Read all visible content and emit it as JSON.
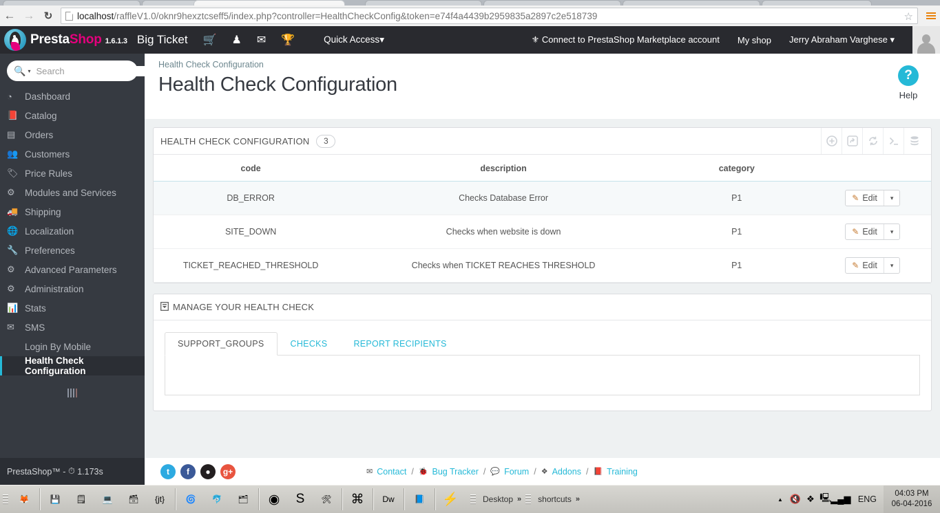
{
  "browser": {
    "back_icon": "back-arrow-icon",
    "forward_icon": "forward-arrow-icon",
    "reload_icon": "reload-icon",
    "url_host": "localhost",
    "url_path": "/raffleV1.0/oknr9hexztcseff5/index.php?controller=HealthCheckConfig&token=e74f4a4439b2959835a2897c2e518739",
    "star_icon": "☆",
    "menu_icon": "menu-icon"
  },
  "header": {
    "brand_presta": "Presta",
    "brand_shop": "Shop",
    "version": "1.6.1.3",
    "shop_name": "Big Ticket",
    "icons": [
      {
        "name": "cart-icon",
        "glyph": "🛒"
      },
      {
        "name": "customers-icon",
        "glyph": "♟"
      },
      {
        "name": "mail-icon",
        "glyph": "✉"
      },
      {
        "name": "trophy-icon",
        "glyph": "🏆"
      }
    ],
    "quick_access": "Quick Access",
    "quick_access_caret": "▾",
    "marketplace_link": "Connect to PrestaShop Marketplace account",
    "marketplace_icon": "⚜",
    "my_shop": "My shop",
    "employee_name": "Jerry Abraham Varghese",
    "employee_caret": "▾",
    "avatar": "avatar-silhouette"
  },
  "sidebar": {
    "search_placeholder": "Search",
    "search_value": "",
    "search_icon": "🔍",
    "search_caret": "▾",
    "items": [
      {
        "label": "Dashboard",
        "icon": "◔",
        "active": false,
        "sub": false
      },
      {
        "label": "Catalog",
        "icon": "📕",
        "active": false,
        "sub": false
      },
      {
        "label": "Orders",
        "icon": "▤",
        "active": false,
        "sub": false
      },
      {
        "label": "Customers",
        "icon": "👥",
        "active": false,
        "sub": false
      },
      {
        "label": "Price Rules",
        "icon": "🏷",
        "active": false,
        "sub": false
      },
      {
        "label": "Modules and Services",
        "icon": "⚙",
        "active": false,
        "sub": false
      },
      {
        "label": "Shipping",
        "icon": "🚚",
        "active": false,
        "sub": false
      },
      {
        "label": "Localization",
        "icon": "🌐",
        "active": false,
        "sub": false
      },
      {
        "label": "Preferences",
        "icon": "🔧",
        "active": false,
        "sub": false
      },
      {
        "label": "Advanced Parameters",
        "icon": "⚙",
        "active": false,
        "sub": false
      },
      {
        "label": "Administration",
        "icon": "⚙",
        "active": false,
        "sub": false
      },
      {
        "label": "Stats",
        "icon": "📊",
        "active": false,
        "sub": false
      },
      {
        "label": "SMS",
        "icon": "✉",
        "active": false,
        "sub": false
      },
      {
        "label": "Login By Mobile",
        "icon": "",
        "active": false,
        "sub": true
      },
      {
        "label": "Health Check Configuration",
        "icon": "",
        "active": true,
        "sub": true
      }
    ],
    "collapse_icon": "grip-icon"
  },
  "page": {
    "breadcrumb": "Health Check Configuration",
    "title": "Health Check Configuration",
    "help_label": "Help",
    "help_glyph": "?"
  },
  "list_panel": {
    "title": "HEALTH CHECK CONFIGURATION",
    "count": "3",
    "tools": [
      {
        "name": "add-new-icon",
        "glyph": "⊕"
      },
      {
        "name": "export-icon",
        "glyph": "↪"
      },
      {
        "name": "refresh-icon",
        "glyph": "⟳"
      },
      {
        "name": "console-icon",
        "glyph": ">_"
      },
      {
        "name": "database-icon",
        "glyph": "≡"
      }
    ],
    "columns": [
      "code",
      "description",
      "category",
      ""
    ],
    "rows": [
      {
        "code": "DB_ERROR",
        "description": "Checks Database Error",
        "category": "P1",
        "action": "Edit"
      },
      {
        "code": "SITE_DOWN",
        "description": "Checks when website is down",
        "category": "P1",
        "action": "Edit"
      },
      {
        "code": "TICKET_REACHED_THRESHOLD",
        "description": "Checks when TICKET REACHES THRESHOLD",
        "category": "P1",
        "action": "Edit"
      }
    ],
    "edit_icon": "✎",
    "caret": "▾"
  },
  "manage_panel": {
    "icon": "🗂",
    "title": "MANAGE YOUR HEALTH CHECK",
    "tabs": [
      {
        "label": "SUPPORT_GROUPS",
        "active": true
      },
      {
        "label": "CHECKS",
        "active": false
      },
      {
        "label": "REPORT RECIPIENTS",
        "active": false
      }
    ]
  },
  "footer": {
    "copyright": "PrestaShop™ -",
    "clock_icon": "⏱",
    "load_time": "1.173s",
    "social": [
      {
        "name": "twitter-icon",
        "glyph": "t",
        "cls": "s-tw"
      },
      {
        "name": "facebook-icon",
        "glyph": "f",
        "cls": "s-fb"
      },
      {
        "name": "github-icon",
        "glyph": "●",
        "cls": "s-gh"
      },
      {
        "name": "google-plus-icon",
        "glyph": "g+",
        "cls": "s-gp"
      }
    ],
    "links": [
      {
        "label": "Contact",
        "icon": "✉"
      },
      {
        "label": "Bug Tracker",
        "icon": "🐞"
      },
      {
        "label": "Forum",
        "icon": "💬"
      },
      {
        "label": "Addons",
        "icon": "❖"
      },
      {
        "label": "Training",
        "icon": "📕"
      }
    ],
    "separator": "/"
  },
  "taskbar": {
    "apps": [
      {
        "name": "firefox-icon",
        "glyph": "🦊"
      },
      {
        "name": "save-icon",
        "glyph": "💾"
      },
      {
        "name": "notepad-icon",
        "glyph": "🗒"
      },
      {
        "name": "remote-icon",
        "glyph": "💻"
      },
      {
        "name": "database-icon",
        "glyph": "🗃"
      },
      {
        "name": "jt-icon",
        "glyph": "{jt}"
      },
      {
        "name": "gimp-icon",
        "glyph": "🌀"
      },
      {
        "name": "mysql-workbench-icon",
        "glyph": "🐬"
      },
      {
        "name": "explorer-icon",
        "glyph": "🗂"
      },
      {
        "name": "chrome-icon",
        "glyph": "◉"
      },
      {
        "name": "skype-icon",
        "glyph": "S"
      },
      {
        "name": "tools-icon",
        "glyph": "🛠"
      },
      {
        "name": "app-icon",
        "glyph": "⌘"
      },
      {
        "name": "dreamweaver-icon",
        "glyph": "Dw"
      },
      {
        "name": "editor-icon",
        "glyph": "📘"
      },
      {
        "name": "tomcat-icon",
        "glyph": "⚡"
      }
    ],
    "toolbars": [
      {
        "label": "Desktop",
        "chevron": "»"
      },
      {
        "label": "shortcuts",
        "chevron": "»"
      }
    ],
    "tray": [
      {
        "name": "show-hidden-icon",
        "glyph": "▲"
      },
      {
        "name": "volume-muted-icon",
        "glyph": "🔇"
      },
      {
        "name": "app-tray-icon",
        "glyph": "❖"
      },
      {
        "name": "network-disconnected-icon",
        "glyph": "🖳"
      },
      {
        "name": "signal-icon",
        "glyph": "▂▄▆"
      }
    ],
    "language": "ENG",
    "time": "04:03 PM",
    "date": "06-04-2016"
  }
}
